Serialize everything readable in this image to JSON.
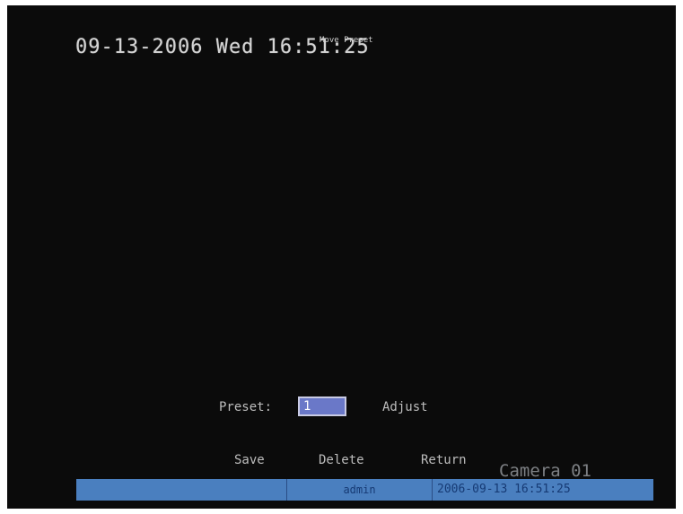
{
  "osd": {
    "datetime": "09-13-2006 Wed 16:51:25",
    "caption": "Move Preset"
  },
  "preset": {
    "label": "Preset:",
    "value": "1"
  },
  "buttons": {
    "adjust": "Adjust",
    "save": "Save",
    "delete": "Delete",
    "return": "Return"
  },
  "camera": "Camera 01",
  "status_bar": {
    "field1": "",
    "user": "admin",
    "datetime": "2006-09-13 16:51:25"
  }
}
